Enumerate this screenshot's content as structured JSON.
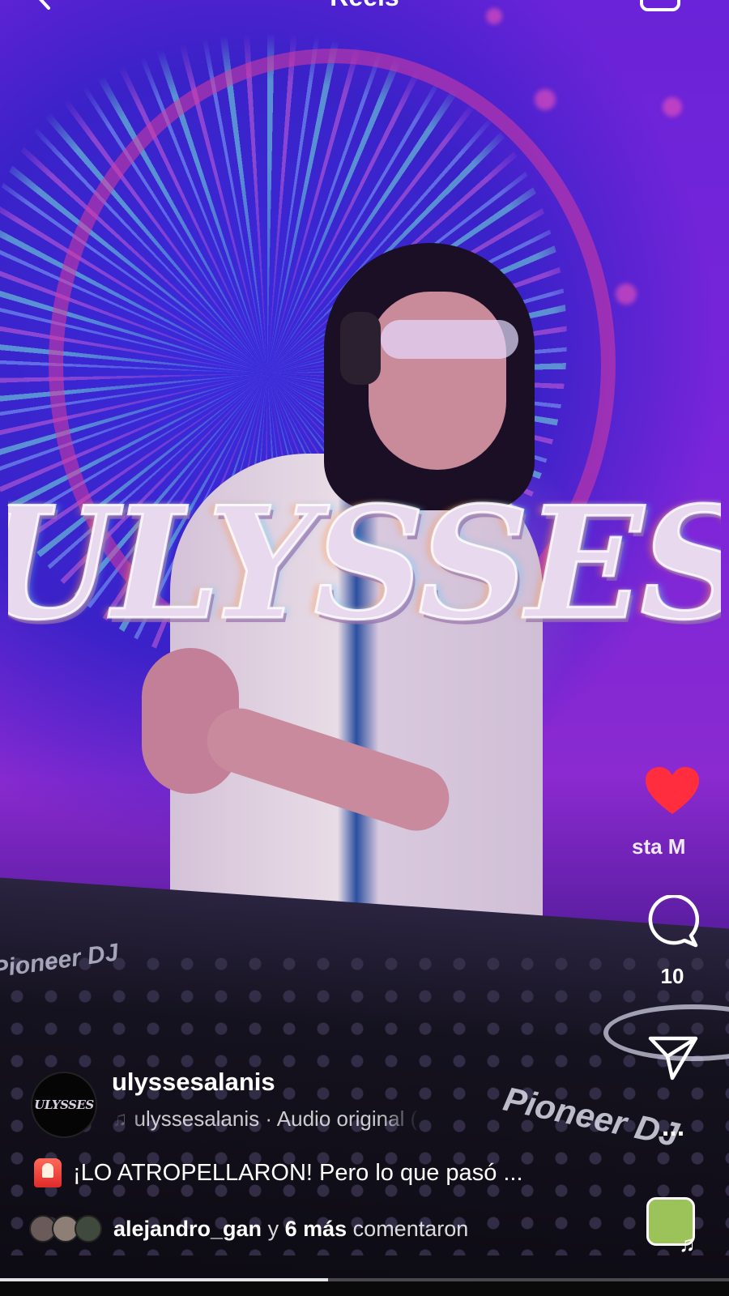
{
  "header": {
    "title": "Reels"
  },
  "overlay": {
    "title_text": "ULYSSES"
  },
  "video": {
    "brand_left": "Pioneer DJ",
    "brand_right": "Pioneer DJ"
  },
  "actions": {
    "like_label": "sta   M",
    "like_color": "#ff2d3d",
    "comment_count": "10",
    "more_label": "..."
  },
  "author": {
    "avatar_text": "ULYSSES",
    "username": "ulyssesalanis",
    "audio_text": "ulyssesalanis · Audio original  (p",
    "audio_icon": "music-note-icon"
  },
  "caption": {
    "icon": "siren-icon",
    "text": "¡LO ATROPELLARON! Pero lo que pasó ..."
  },
  "comments_summary": {
    "user": "alejandro_gan",
    "connector": "y",
    "count_text": "6 más",
    "suffix": "comentaron"
  },
  "progress": {
    "fraction": 0.45
  }
}
